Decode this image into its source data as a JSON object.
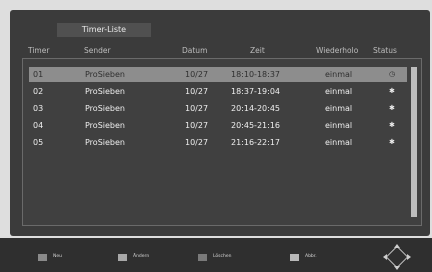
{
  "panel": {
    "title": "Timer-Liste"
  },
  "columns": [
    "Timer",
    "Sender",
    "Datum",
    "Zeit",
    "Wiederholo",
    "Status"
  ],
  "rows": [
    {
      "timer": "01",
      "sender": "ProSieben",
      "date": "10/27",
      "time": "18:10-18:37",
      "repeat": "einmal",
      "status": "◷",
      "selected": true
    },
    {
      "timer": "02",
      "sender": "ProSieben",
      "date": "10/27",
      "time": "18:37-19:04",
      "repeat": "einmal",
      "status": "✱",
      "selected": false
    },
    {
      "timer": "03",
      "sender": "ProSieben",
      "date": "10/27",
      "time": "20:14-20:45",
      "repeat": "einmal",
      "status": "✱",
      "selected": false
    },
    {
      "timer": "04",
      "sender": "ProSieben",
      "date": "10/27",
      "time": "20:45-21:16",
      "repeat": "einmal",
      "status": "✱",
      "selected": false
    },
    {
      "timer": "05",
      "sender": "ProSieben",
      "date": "10/27",
      "time": "21:16-22:17",
      "repeat": "einmal",
      "status": "✱",
      "selected": false
    }
  ],
  "bottom_bar": {
    "new_label": "Neu",
    "change_label": "Ändern",
    "delete_label": "Löschen",
    "exit_label": "Abbr."
  }
}
